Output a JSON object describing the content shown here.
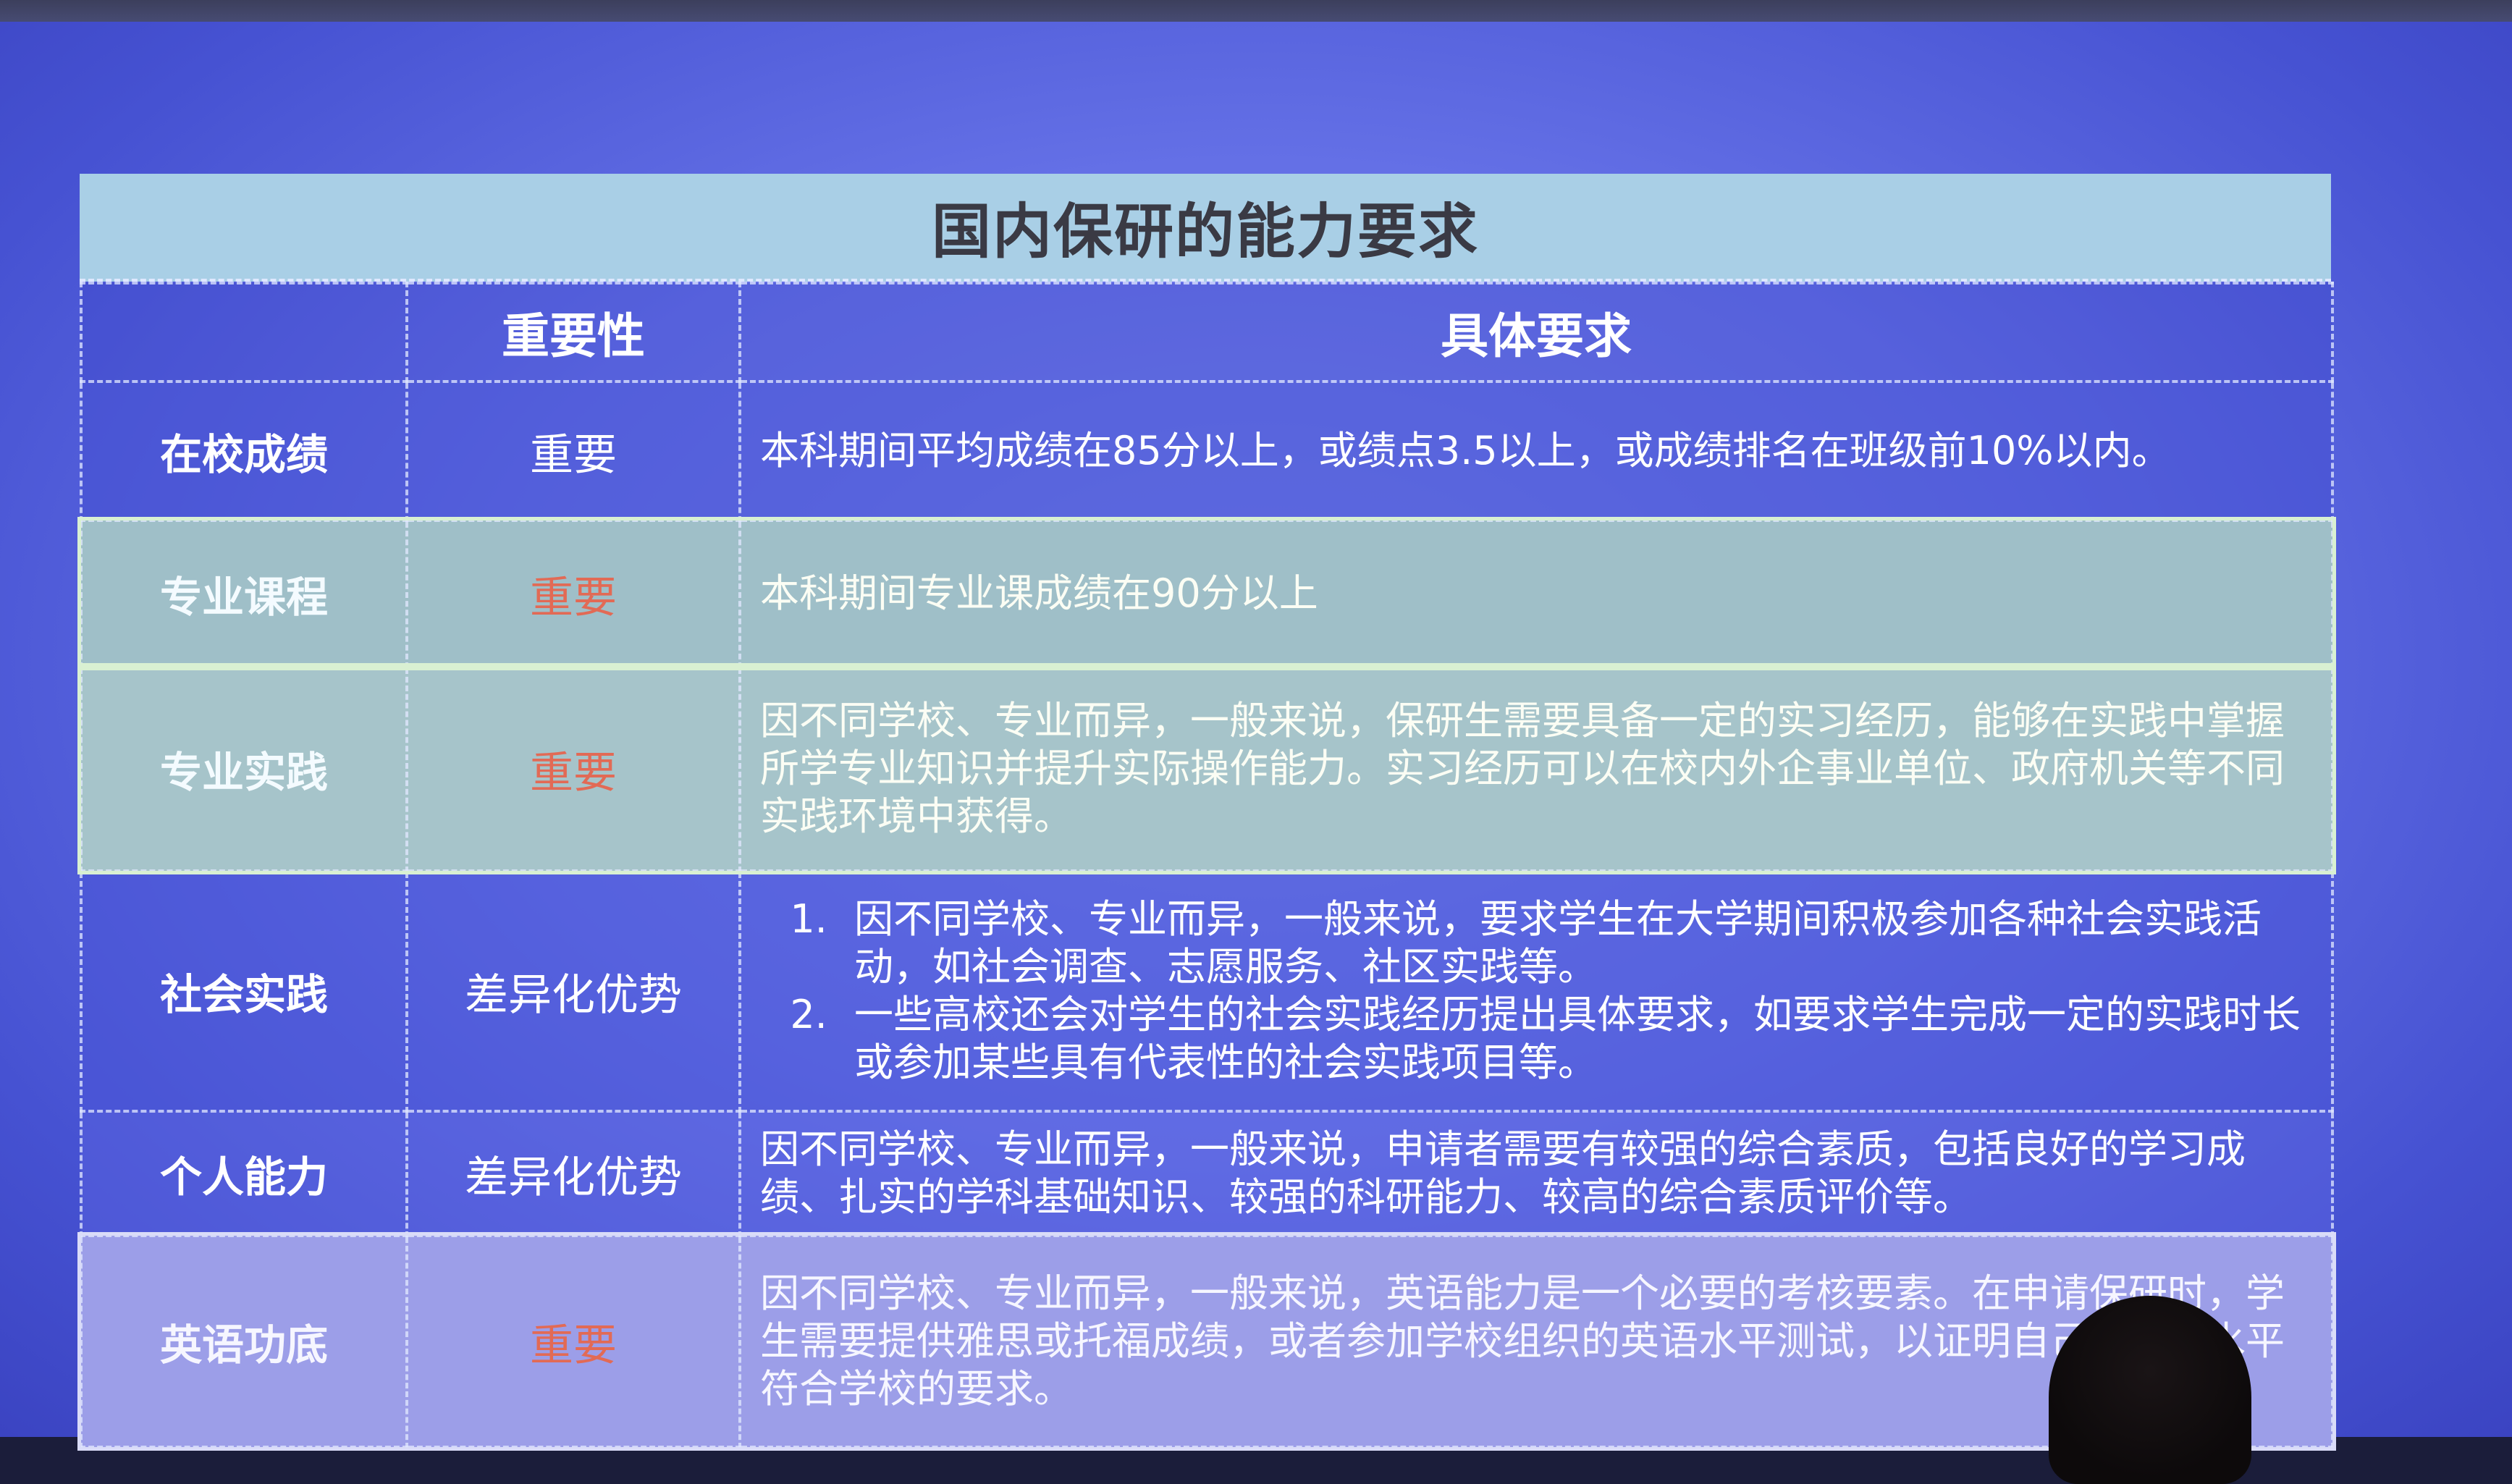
{
  "slide": {
    "title": "国内保研的能力要求",
    "headers": {
      "category": "",
      "importance": "重要性",
      "requirement": "具体要求"
    },
    "rows": [
      {
        "category": "在校成绩",
        "importance": "重要",
        "requirement": "本科期间平均成绩在85分以上，或绩点3.5以上，或成绩排名在班级前10%以内。"
      },
      {
        "category": "专业课程",
        "importance": "重要",
        "requirement": "本科期间专业课成绩在90分以上"
      },
      {
        "category": "专业实践",
        "importance": "重要",
        "requirement": "因不同学校、专业而异，一般来说，保研生需要具备一定的实习经历，能够在实践中掌握所学专业知识并提升实际操作能力。实习经历可以在校内外企事业单位、政府机关等不同实践环境中获得。"
      },
      {
        "category": "社会实践",
        "importance": "差异化优势",
        "requirement_items": [
          "因不同学校、专业而异，一般来说，要求学生在大学期间积极参加各种社会实践活动，如社会调查、志愿服务、社区实践等。",
          "一些高校还会对学生的社会实践经历提出具体要求，如要求学生完成一定的实践时长或参加某些具有代表性的社会实践项目等。"
        ]
      },
      {
        "category": "个人能力",
        "importance": "差异化优势",
        "requirement": "因不同学校、专业而异，一般来说，申请者需要有较强的综合素质，包括良好的学习成绩、扎实的学科基础知识、较强的科研能力、较高的综合素质评价等。"
      },
      {
        "category": "英语功底",
        "importance": "重要",
        "requirement": "因不同学校、专业而异，一般来说，英语能力是一个必要的考核要素。在申请保研时，学生需要提供雅思或托福成绩，或者参加学校组织的英语水平测试，以证明自己的英语水平符合学校的要求。"
      }
    ]
  },
  "colors": {
    "title_bar": "#a9cfe6",
    "screen": "#6470e6",
    "highlight_green": "#a6c4ca",
    "highlight_purple": "#9c9ee8",
    "importance_red": "#e26a55"
  }
}
